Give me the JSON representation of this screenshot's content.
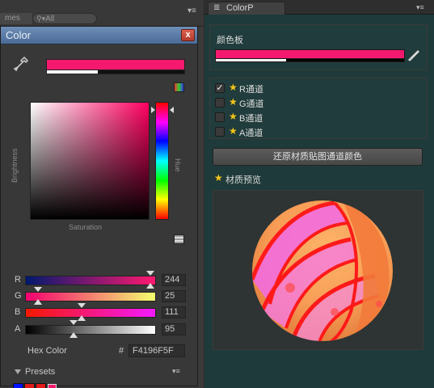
{
  "background": {
    "tab_fragment": "mes",
    "search_fragment": "All"
  },
  "color_window": {
    "title": "Color",
    "close_glyph": "x",
    "current_color_hex": "#f4196f",
    "brightness_label": "Brightness",
    "saturation_label": "Saturation",
    "hue_label": "Hue",
    "channels": [
      {
        "label": "R",
        "value": "244",
        "gradient": "linear-gradient(90deg,#00196f,#ff196f)",
        "fraction": 0.957
      },
      {
        "label": "G",
        "value": "25",
        "gradient": "linear-gradient(90deg,#f4006f,#f4ff6f)",
        "fraction": 0.098
      },
      {
        "label": "B",
        "value": "111",
        "gradient": "linear-gradient(90deg,#f41900,#f419ff)",
        "fraction": 0.435
      },
      {
        "label": "A",
        "value": "95",
        "gradient": "linear-gradient(90deg,#000,#fff)",
        "fraction": 0.373
      }
    ],
    "hex_label": "Hex Color",
    "hex_hash": "#",
    "hex_value": "F4196F5F",
    "presets_label": "Presets",
    "presets": [
      "#0012ff",
      "#e01b1b",
      "#e21a1a",
      "#f4196f"
    ],
    "alpha_fraction": 0.373
  },
  "right_panel": {
    "tab_title": "ColorP",
    "tab_icon": "list-icon",
    "palette_label": "颜色板",
    "palette_color_hex": "#f4196f",
    "channels": [
      {
        "label": "R通道",
        "checked": true
      },
      {
        "label": "G通道",
        "checked": false
      },
      {
        "label": "B通道",
        "checked": false
      },
      {
        "label": "A通道",
        "checked": false
      }
    ],
    "restore_button": "还原材质贴图通道颜色",
    "preview_label": "材质预览"
  }
}
